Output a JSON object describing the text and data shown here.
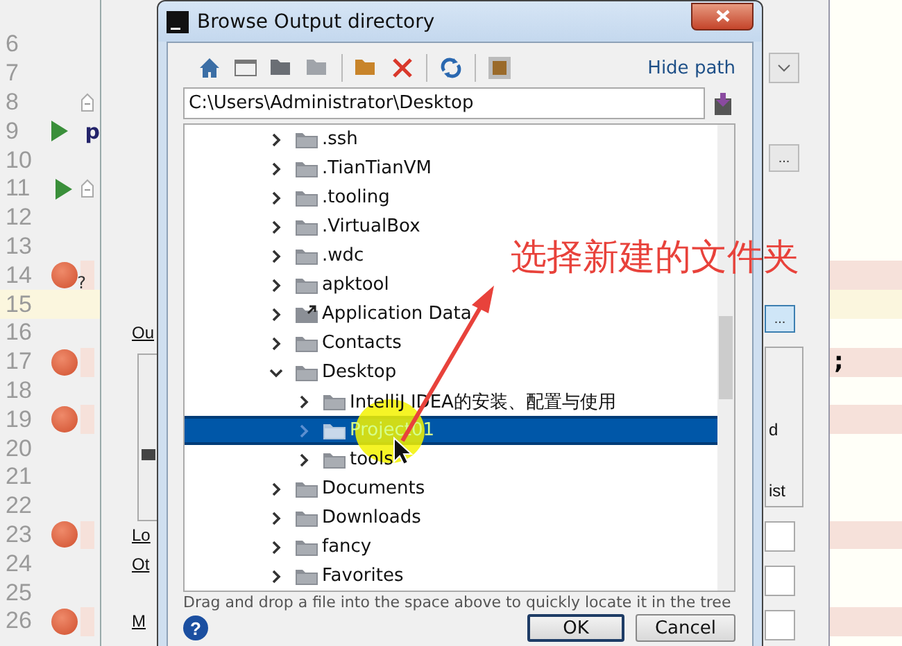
{
  "gutter": {
    "lines": [
      {
        "number": "6",
        "breakpoint": false,
        "run": false,
        "fold": false,
        "current": false
      },
      {
        "number": "7",
        "breakpoint": false,
        "run": false,
        "fold": false,
        "current": false
      },
      {
        "number": "8",
        "breakpoint": false,
        "run": false,
        "fold": true,
        "current": false
      },
      {
        "number": "9",
        "breakpoint": false,
        "run": true,
        "fold": false,
        "current": false,
        "left_fragment": "p"
      },
      {
        "number": "10",
        "breakpoint": false,
        "run": false,
        "fold": false,
        "current": false
      },
      {
        "number": "11",
        "breakpoint": false,
        "run": true,
        "fold": true,
        "current": false
      },
      {
        "number": "12",
        "breakpoint": false,
        "run": false,
        "fold": false,
        "current": false
      },
      {
        "number": "13",
        "breakpoint": false,
        "run": false,
        "fold": false,
        "current": false
      },
      {
        "number": "14",
        "breakpoint": true,
        "run": false,
        "fold": false,
        "current": false,
        "badge": "?"
      },
      {
        "number": "15",
        "breakpoint": false,
        "run": false,
        "fold": false,
        "current": true
      },
      {
        "number": "16",
        "breakpoint": false,
        "run": false,
        "fold": false,
        "current": false
      },
      {
        "number": "17",
        "breakpoint": true,
        "run": false,
        "fold": false,
        "current": false,
        "code": ";"
      },
      {
        "number": "18",
        "breakpoint": false,
        "run": false,
        "fold": false,
        "current": false
      },
      {
        "number": "19",
        "breakpoint": true,
        "run": false,
        "fold": false,
        "current": false
      },
      {
        "number": "20",
        "breakpoint": false,
        "run": false,
        "fold": false,
        "current": false
      },
      {
        "number": "21",
        "breakpoint": false,
        "run": false,
        "fold": false,
        "current": false
      },
      {
        "number": "22",
        "breakpoint": false,
        "run": false,
        "fold": false,
        "current": false
      },
      {
        "number": "23",
        "breakpoint": true,
        "run": false,
        "fold": false,
        "current": false
      },
      {
        "number": "24",
        "breakpoint": false,
        "run": false,
        "fold": false,
        "current": false
      },
      {
        "number": "25",
        "breakpoint": false,
        "run": false,
        "fold": false,
        "current": false
      },
      {
        "number": "26",
        "breakpoint": true,
        "run": false,
        "fold": false,
        "current": false
      }
    ]
  },
  "back_dialog": {
    "left_labels": [
      "Ou",
      "Lo",
      "Ot",
      "M"
    ],
    "browse_buttons": [
      {
        "label": "...",
        "selected": false
      },
      {
        "label": "...",
        "selected": true
      }
    ],
    "right_labels": [
      "d",
      "ist"
    ]
  },
  "dialog": {
    "title": "Browse Output directory",
    "hide_path": "Hide path",
    "path": "C:\\Users\\Administrator\\Desktop",
    "tree": [
      {
        "name": ".ssh",
        "kind": "folder",
        "expanded": false,
        "selected": false
      },
      {
        "name": ".TianTianVM",
        "kind": "folder",
        "expanded": false,
        "selected": false
      },
      {
        "name": ".tooling",
        "kind": "folder",
        "expanded": false,
        "selected": false
      },
      {
        "name": ".VirtualBox",
        "kind": "folder",
        "expanded": false,
        "selected": false
      },
      {
        "name": ".wdc",
        "kind": "folder",
        "expanded": false,
        "selected": false
      },
      {
        "name": "apktool",
        "kind": "folder",
        "expanded": false,
        "selected": false
      },
      {
        "name": "Application Data",
        "kind": "shortcut",
        "expanded": false,
        "selected": false
      },
      {
        "name": "Contacts",
        "kind": "folder",
        "expanded": false,
        "selected": false
      },
      {
        "name": "Desktop",
        "kind": "folder",
        "expanded": true,
        "selected": false,
        "children": [
          {
            "name": "IntelliJ IDEA的安装、配置与使用",
            "kind": "folder",
            "expanded": false,
            "selected": false
          },
          {
            "name": "Project01",
            "kind": "folder",
            "expanded": false,
            "selected": true
          },
          {
            "name": "tools",
            "kind": "folder",
            "expanded": false,
            "selected": false
          }
        ]
      },
      {
        "name": "Documents",
        "kind": "folder",
        "expanded": false,
        "selected": false
      },
      {
        "name": "Downloads",
        "kind": "folder",
        "expanded": false,
        "selected": false
      },
      {
        "name": "fancy",
        "kind": "folder",
        "expanded": false,
        "selected": false
      },
      {
        "name": "Favorites",
        "kind": "folder",
        "expanded": false,
        "selected": false
      }
    ],
    "hint": "Drag and drop a file into the space above to quickly locate it in the tree",
    "help": "?",
    "buttons": [
      {
        "label": "OK",
        "default": true
      },
      {
        "label": "Cancel",
        "default": false
      }
    ]
  },
  "annotation": {
    "text": "选择新建的文件夹"
  }
}
